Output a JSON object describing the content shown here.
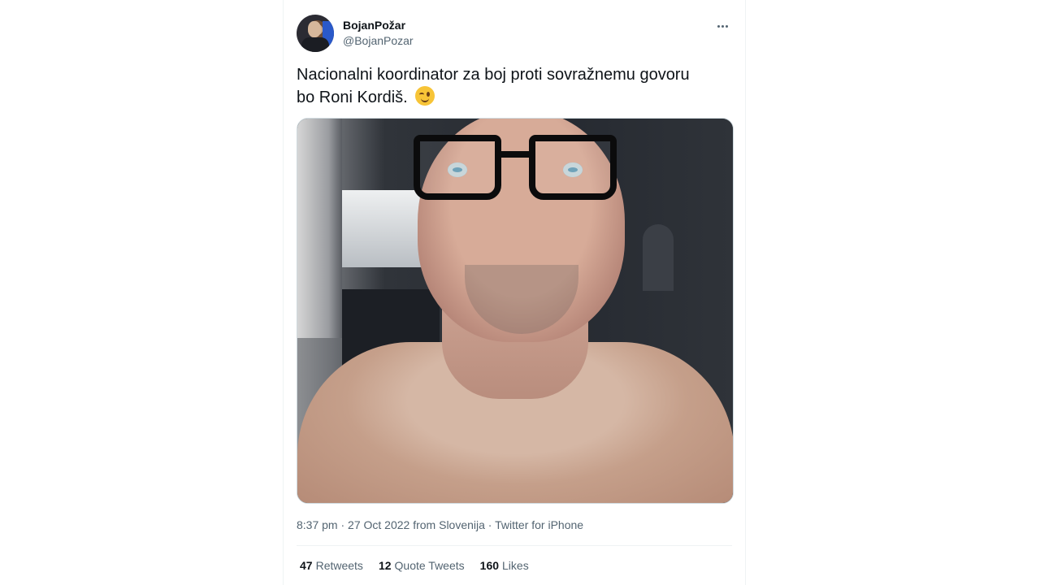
{
  "tweet": {
    "author": {
      "display_name": "BojanPožar",
      "handle": "@BojanPozar",
      "avatar_icon": "profile-avatar"
    },
    "text_line_1": "Nacionalni koordinator za boj proti sovražnemu govoru",
    "text_line_2": "bo Roni Kordiš.",
    "emoji": "winking-face",
    "meta": {
      "time": "8:37 pm",
      "separator_1": " · ",
      "date": "27 Oct 2022",
      "location": " from Slovenija",
      "separator_2": " · ",
      "source": "Twitter for iPhone"
    },
    "stats": {
      "retweets_count": "47",
      "retweets_label": "Retweets",
      "quote_tweets_count": "12",
      "quote_tweets_label": "Quote Tweets",
      "likes_count": "160",
      "likes_label": "Likes"
    }
  },
  "colors": {
    "primary_text": "#0f1419",
    "secondary_text": "#536471",
    "border": "#eff3f4",
    "emoji_yellow": "#f7c437"
  }
}
